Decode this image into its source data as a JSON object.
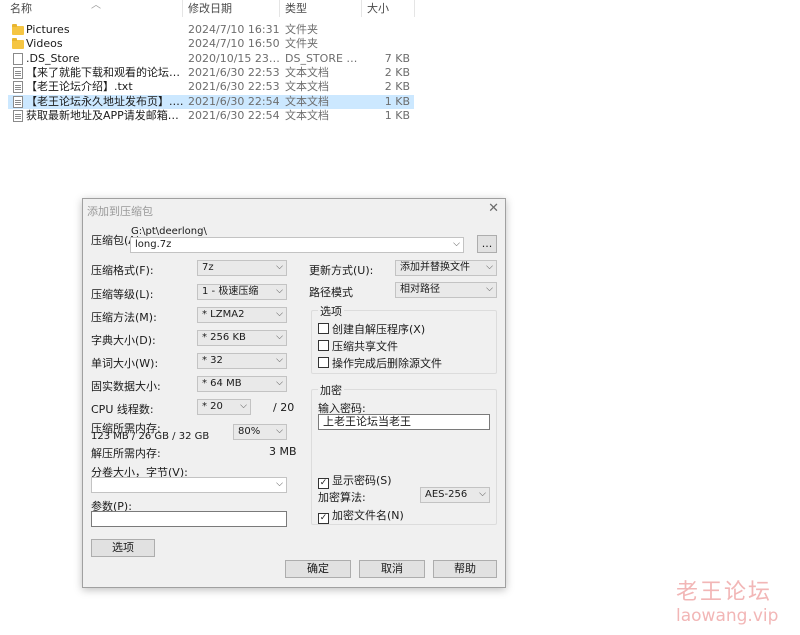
{
  "explorer": {
    "columns": [
      "名称",
      "修改日期",
      "类型",
      "大小"
    ],
    "rows": [
      {
        "name": "Pictures",
        "date": "2024/7/10 16:31",
        "type": "文件夹",
        "size": "",
        "icon": "folder-icon"
      },
      {
        "name": "Videos",
        "date": "2024/7/10 16:50",
        "type": "文件夹",
        "size": "",
        "icon": "folder-icon"
      },
      {
        "name": ".DS_Store",
        "date": "2020/10/15 23:36",
        "type": "DS_STORE 文件",
        "size": "7 KB",
        "icon": "file-icon"
      },
      {
        "name": "【来了就能下载和观看的论坛，纯免费！...",
        "date": "2021/6/30 22:53",
        "type": "文本文档",
        "size": "2 KB",
        "icon": "text-file-icon"
      },
      {
        "name": "【老王论坛介绍】.txt",
        "date": "2021/6/30 22:53",
        "type": "文本文档",
        "size": "2 KB",
        "icon": "text-file-icon"
      },
      {
        "name": "【老王论坛永久地址发布页】.txt",
        "date": "2021/6/30 22:54",
        "type": "文本文档",
        "size": "1 KB",
        "icon": "text-file-icon",
        "selected": true
      },
      {
        "name": "获取最新地址及APP请发邮箱自动获取.txt",
        "date": "2021/6/30 22:54",
        "type": "文本文档",
        "size": "1 KB",
        "icon": "text-file-icon"
      }
    ]
  },
  "dialog": {
    "title": "添加到压缩包",
    "archive_label": "压缩包(A):",
    "archive_path": "G:\\pt\\deerlong\\",
    "archive_name": "long.7z",
    "browse_label": "...",
    "format_label": "压缩格式(F):",
    "format_value": "7z",
    "level_label": "压缩等级(L):",
    "level_value": "1 - 极速压缩",
    "method_label": "压缩方法(M):",
    "method_value": "* LZMA2",
    "dict_label": "字典大小(D):",
    "dict_value": "* 256 KB",
    "word_label": "单词大小(W):",
    "word_value": "* 32",
    "solid_label": "固实数据大小:",
    "solid_value": "* 64 MB",
    "threads_label": "CPU 线程数:",
    "threads_value": "* 20",
    "threads_max": "/ 20",
    "mem_comp_label": "压缩所需内存:",
    "mem_comp_value": "123 MB / 26 GB / 32 GB",
    "mem_percent": "80%",
    "mem_decomp_label": "解压所需内存:",
    "mem_decomp_value": "3 MB",
    "split_label": "分卷大小，字节(V):",
    "split_value": "",
    "params_label": "参数(P):",
    "params_value": "",
    "options_button": "选项",
    "update_label": "更新方式(U):",
    "update_value": "添加并替换文件",
    "path_label": "路径模式",
    "path_value": "相对路径",
    "options_group": "选项",
    "opt_sfx": "创建自解压程序(X)",
    "opt_shared": "压缩共享文件",
    "opt_delete": "操作完成后删除源文件",
    "encrypt_group": "加密",
    "password_label": "输入密码:",
    "password_value": "上老王论坛当老王",
    "show_password": "显示密码(S)",
    "algo_label": "加密算法:",
    "algo_value": "AES-256",
    "encrypt_names": "加密文件名(N)",
    "ok": "确定",
    "cancel": "取消",
    "help": "帮助"
  },
  "watermark": {
    "cn": "老王论坛",
    "en": "laowang.vip"
  }
}
